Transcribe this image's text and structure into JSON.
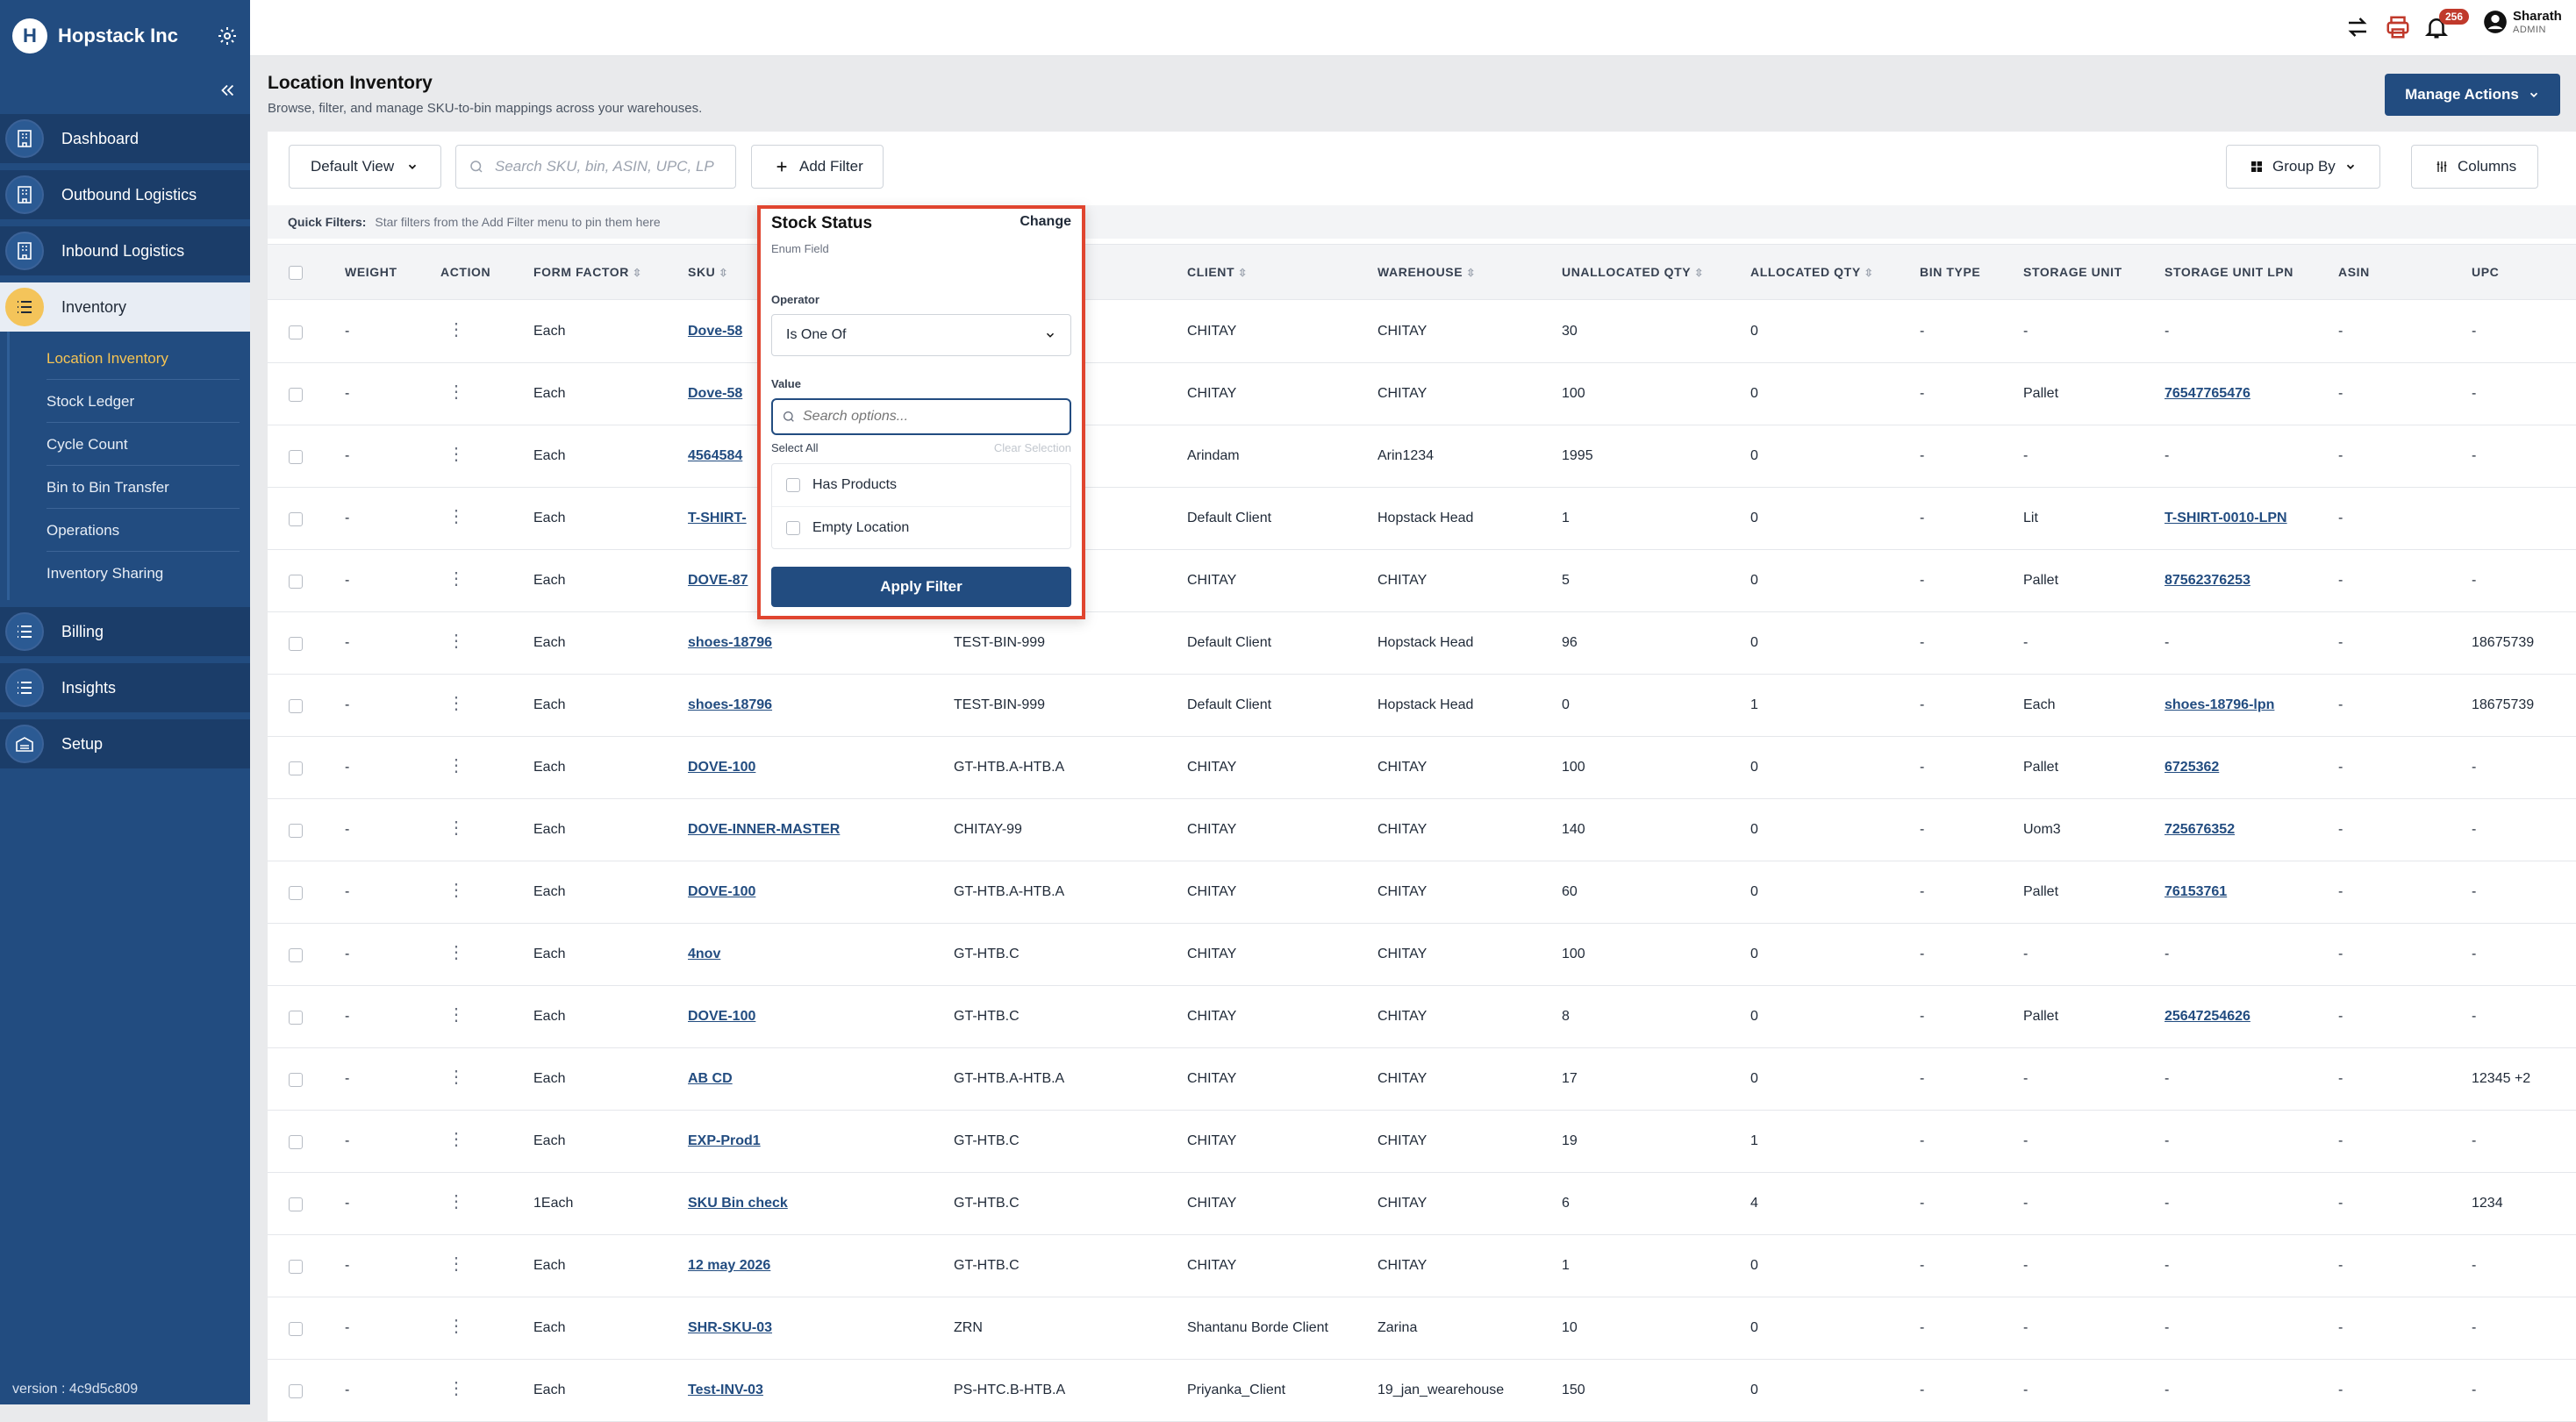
{
  "sidebar": {
    "brand": "Hopstack Inc",
    "items": [
      {
        "label": "Dashboard"
      },
      {
        "label": "Outbound Logistics"
      },
      {
        "label": "Inbound Logistics"
      },
      {
        "label": "Inventory"
      },
      {
        "label": "Billing"
      },
      {
        "label": "Insights"
      },
      {
        "label": "Setup"
      }
    ],
    "inventory_sub": [
      {
        "label": "Location Inventory"
      },
      {
        "label": "Stock Ledger"
      },
      {
        "label": "Cycle Count"
      },
      {
        "label": "Bin to Bin Transfer"
      },
      {
        "label": "Operations"
      },
      {
        "label": "Inventory Sharing"
      }
    ],
    "version": "version : 4c9d5c809"
  },
  "topbar": {
    "notification_count": "256",
    "user_name": "Sharath",
    "user_role": "ADMIN"
  },
  "page": {
    "title": "Location Inventory",
    "subtitle": "Browse, filter, and manage SKU-to-bin mappings across your warehouses.",
    "manage_actions": "Manage Actions"
  },
  "toolbar": {
    "default_view": "Default View",
    "search_placeholder": "Search SKU, bin, ASIN, UPC, LP",
    "add_filter": "Add Filter",
    "group_by": "Group By",
    "columns": "Columns",
    "quick_filters_label": "Quick Filters:",
    "quick_filters_hint": "Star filters from the Add Filter menu to pin them here"
  },
  "table": {
    "headers": {
      "weight": "WEIGHT",
      "action": "ACTION",
      "form_factor": "FORM FACTOR",
      "sku": "SKU",
      "client": "CLIENT",
      "warehouse": "WAREHOUSE",
      "unallocated": "UNALLOCATED QTY",
      "allocated": "ALLOCATED QTY",
      "bin_type": "BIN TYPE",
      "storage_unit": "STORAGE UNIT",
      "storage_unit_lpn": "STORAGE UNIT LPN",
      "asin": "ASIN",
      "upc": "UPC"
    },
    "rows": [
      {
        "weight": "-",
        "ff": "Each",
        "sku": "Dove-58",
        "bin": "",
        "client": "CHITAY",
        "wh": "CHITAY",
        "unalloc": "30",
        "alloc": "0",
        "bintype": "-",
        "su": "-",
        "lpn": "-",
        "asin": "-",
        "upc": "-"
      },
      {
        "weight": "-",
        "ff": "Each",
        "sku": "Dove-58",
        "bin": "",
        "client": "CHITAY",
        "wh": "CHITAY",
        "unalloc": "100",
        "alloc": "0",
        "bintype": "-",
        "su": "Pallet",
        "lpn": "76547765476",
        "asin": "-",
        "upc": "-"
      },
      {
        "weight": "-",
        "ff": "Each",
        "sku": "4564584",
        "bin": "",
        "client": "Arindam",
        "wh": "Arin1234",
        "unalloc": "1995",
        "alloc": "0",
        "bintype": "-",
        "su": "-",
        "lpn": "-",
        "asin": "-",
        "upc": "-"
      },
      {
        "weight": "-",
        "ff": "Each",
        "sku": "T-SHIRT-",
        "bin": "",
        "client": "Default Client",
        "wh": "Hopstack Head",
        "unalloc": "1",
        "alloc": "0",
        "bintype": "-",
        "su": "Lit",
        "lpn": "T-SHIRT-0010-LPN",
        "asin": "-",
        "upc": ""
      },
      {
        "weight": "-",
        "ff": "Each",
        "sku": "DOVE-87",
        "bin": "",
        "client": "CHITAY",
        "wh": "CHITAY",
        "unalloc": "5",
        "alloc": "0",
        "bintype": "-",
        "su": "Pallet",
        "lpn": "87562376253",
        "asin": "-",
        "upc": "-"
      },
      {
        "weight": "-",
        "ff": "Each",
        "sku": "shoes-18796",
        "bin": "TEST-BIN-999",
        "client": "Default Client",
        "wh": "Hopstack Head",
        "unalloc": "96",
        "alloc": "0",
        "bintype": "-",
        "su": "-",
        "lpn": "-",
        "asin": "-",
        "upc": "18675739"
      },
      {
        "weight": "-",
        "ff": "Each",
        "sku": "shoes-18796",
        "bin": "TEST-BIN-999",
        "client": "Default Client",
        "wh": "Hopstack Head",
        "unalloc": "0",
        "alloc": "1",
        "bintype": "-",
        "su": "Each",
        "lpn": "shoes-18796-lpn",
        "asin": "-",
        "upc": "18675739"
      },
      {
        "weight": "-",
        "ff": "Each",
        "sku": "DOVE-100",
        "bin": "GT-HTB.A-HTB.A",
        "client": "CHITAY",
        "wh": "CHITAY",
        "unalloc": "100",
        "alloc": "0",
        "bintype": "-",
        "su": "Pallet",
        "lpn": "6725362",
        "asin": "-",
        "upc": "-"
      },
      {
        "weight": "-",
        "ff": "Each",
        "sku": "DOVE-INNER-MASTER",
        "bin": "CHITAY-99",
        "client": "CHITAY",
        "wh": "CHITAY",
        "unalloc": "140",
        "alloc": "0",
        "bintype": "-",
        "su": "Uom3",
        "lpn": "725676352",
        "asin": "-",
        "upc": "-"
      },
      {
        "weight": "-",
        "ff": "Each",
        "sku": "DOVE-100",
        "bin": "GT-HTB.A-HTB.A",
        "client": "CHITAY",
        "wh": "CHITAY",
        "unalloc": "60",
        "alloc": "0",
        "bintype": "-",
        "su": "Pallet",
        "lpn": "76153761",
        "asin": "-",
        "upc": "-"
      },
      {
        "weight": "-",
        "ff": "Each",
        "sku": "4nov",
        "bin": "GT-HTB.C",
        "client": "CHITAY",
        "wh": "CHITAY",
        "unalloc": "100",
        "alloc": "0",
        "bintype": "-",
        "su": "-",
        "lpn": "-",
        "asin": "-",
        "upc": "-"
      },
      {
        "weight": "-",
        "ff": "Each",
        "sku": "DOVE-100",
        "bin": "GT-HTB.C",
        "client": "CHITAY",
        "wh": "CHITAY",
        "unalloc": "8",
        "alloc": "0",
        "bintype": "-",
        "su": "Pallet",
        "lpn": "25647254626",
        "asin": "-",
        "upc": "-"
      },
      {
        "weight": "-",
        "ff": "Each",
        "sku": "AB CD",
        "bin": "GT-HTB.A-HTB.A",
        "client": "CHITAY",
        "wh": "CHITAY",
        "unalloc": "17",
        "alloc": "0",
        "bintype": "-",
        "su": "-",
        "lpn": "-",
        "asin": "-",
        "upc": "12345 +2"
      },
      {
        "weight": "-",
        "ff": "Each",
        "sku": "EXP-Prod1",
        "bin": "GT-HTB.C",
        "client": "CHITAY",
        "wh": "CHITAY",
        "unalloc": "19",
        "alloc": "1",
        "bintype": "-",
        "su": "-",
        "lpn": "-",
        "asin": "-",
        "upc": "-"
      },
      {
        "weight": "-",
        "ff": "1Each",
        "sku": "SKU Bin check",
        "bin": "GT-HTB.C",
        "client": "CHITAY",
        "wh": "CHITAY",
        "unalloc": "6",
        "alloc": "4",
        "bintype": "-",
        "su": "-",
        "lpn": "-",
        "asin": "-",
        "upc": "1234"
      },
      {
        "weight": "-",
        "ff": "Each",
        "sku": "12 may 2026",
        "bin": "GT-HTB.C",
        "client": "CHITAY",
        "wh": "CHITAY",
        "unalloc": "1",
        "alloc": "0",
        "bintype": "-",
        "su": "-",
        "lpn": "-",
        "asin": "-",
        "upc": "-"
      },
      {
        "weight": "-",
        "ff": "Each",
        "sku": "SHR-SKU-03",
        "bin": "ZRN",
        "client": "Shantanu Borde Client",
        "wh": "Zarina",
        "unalloc": "10",
        "alloc": "0",
        "bintype": "-",
        "su": "-",
        "lpn": "-",
        "asin": "-",
        "upc": "-"
      },
      {
        "weight": "-",
        "ff": "Each",
        "sku": "Test-INV-03",
        "bin": "PS-HTC.B-HTB.A",
        "client": "Priyanka_Client",
        "wh": "19_jan_wearehouse",
        "unalloc": "150",
        "alloc": "0",
        "bintype": "-",
        "su": "-",
        "lpn": "-",
        "asin": "-",
        "upc": "-"
      }
    ]
  },
  "filter_popover": {
    "title": "Stock Status",
    "change": "Change",
    "subtitle": "Enum Field",
    "operator_label": "Operator",
    "operator_value": "Is One Of",
    "value_label": "Value",
    "search_placeholder": "Search options...",
    "select_all": "Select All",
    "clear_selection": "Clear Selection",
    "options": [
      {
        "label": "Has Products"
      },
      {
        "label": "Empty Location"
      }
    ],
    "apply": "Apply Filter"
  },
  "colors": {
    "sidebar": "#224c80",
    "accent": "#f4c45a",
    "highlight_border": "#e0452f"
  }
}
